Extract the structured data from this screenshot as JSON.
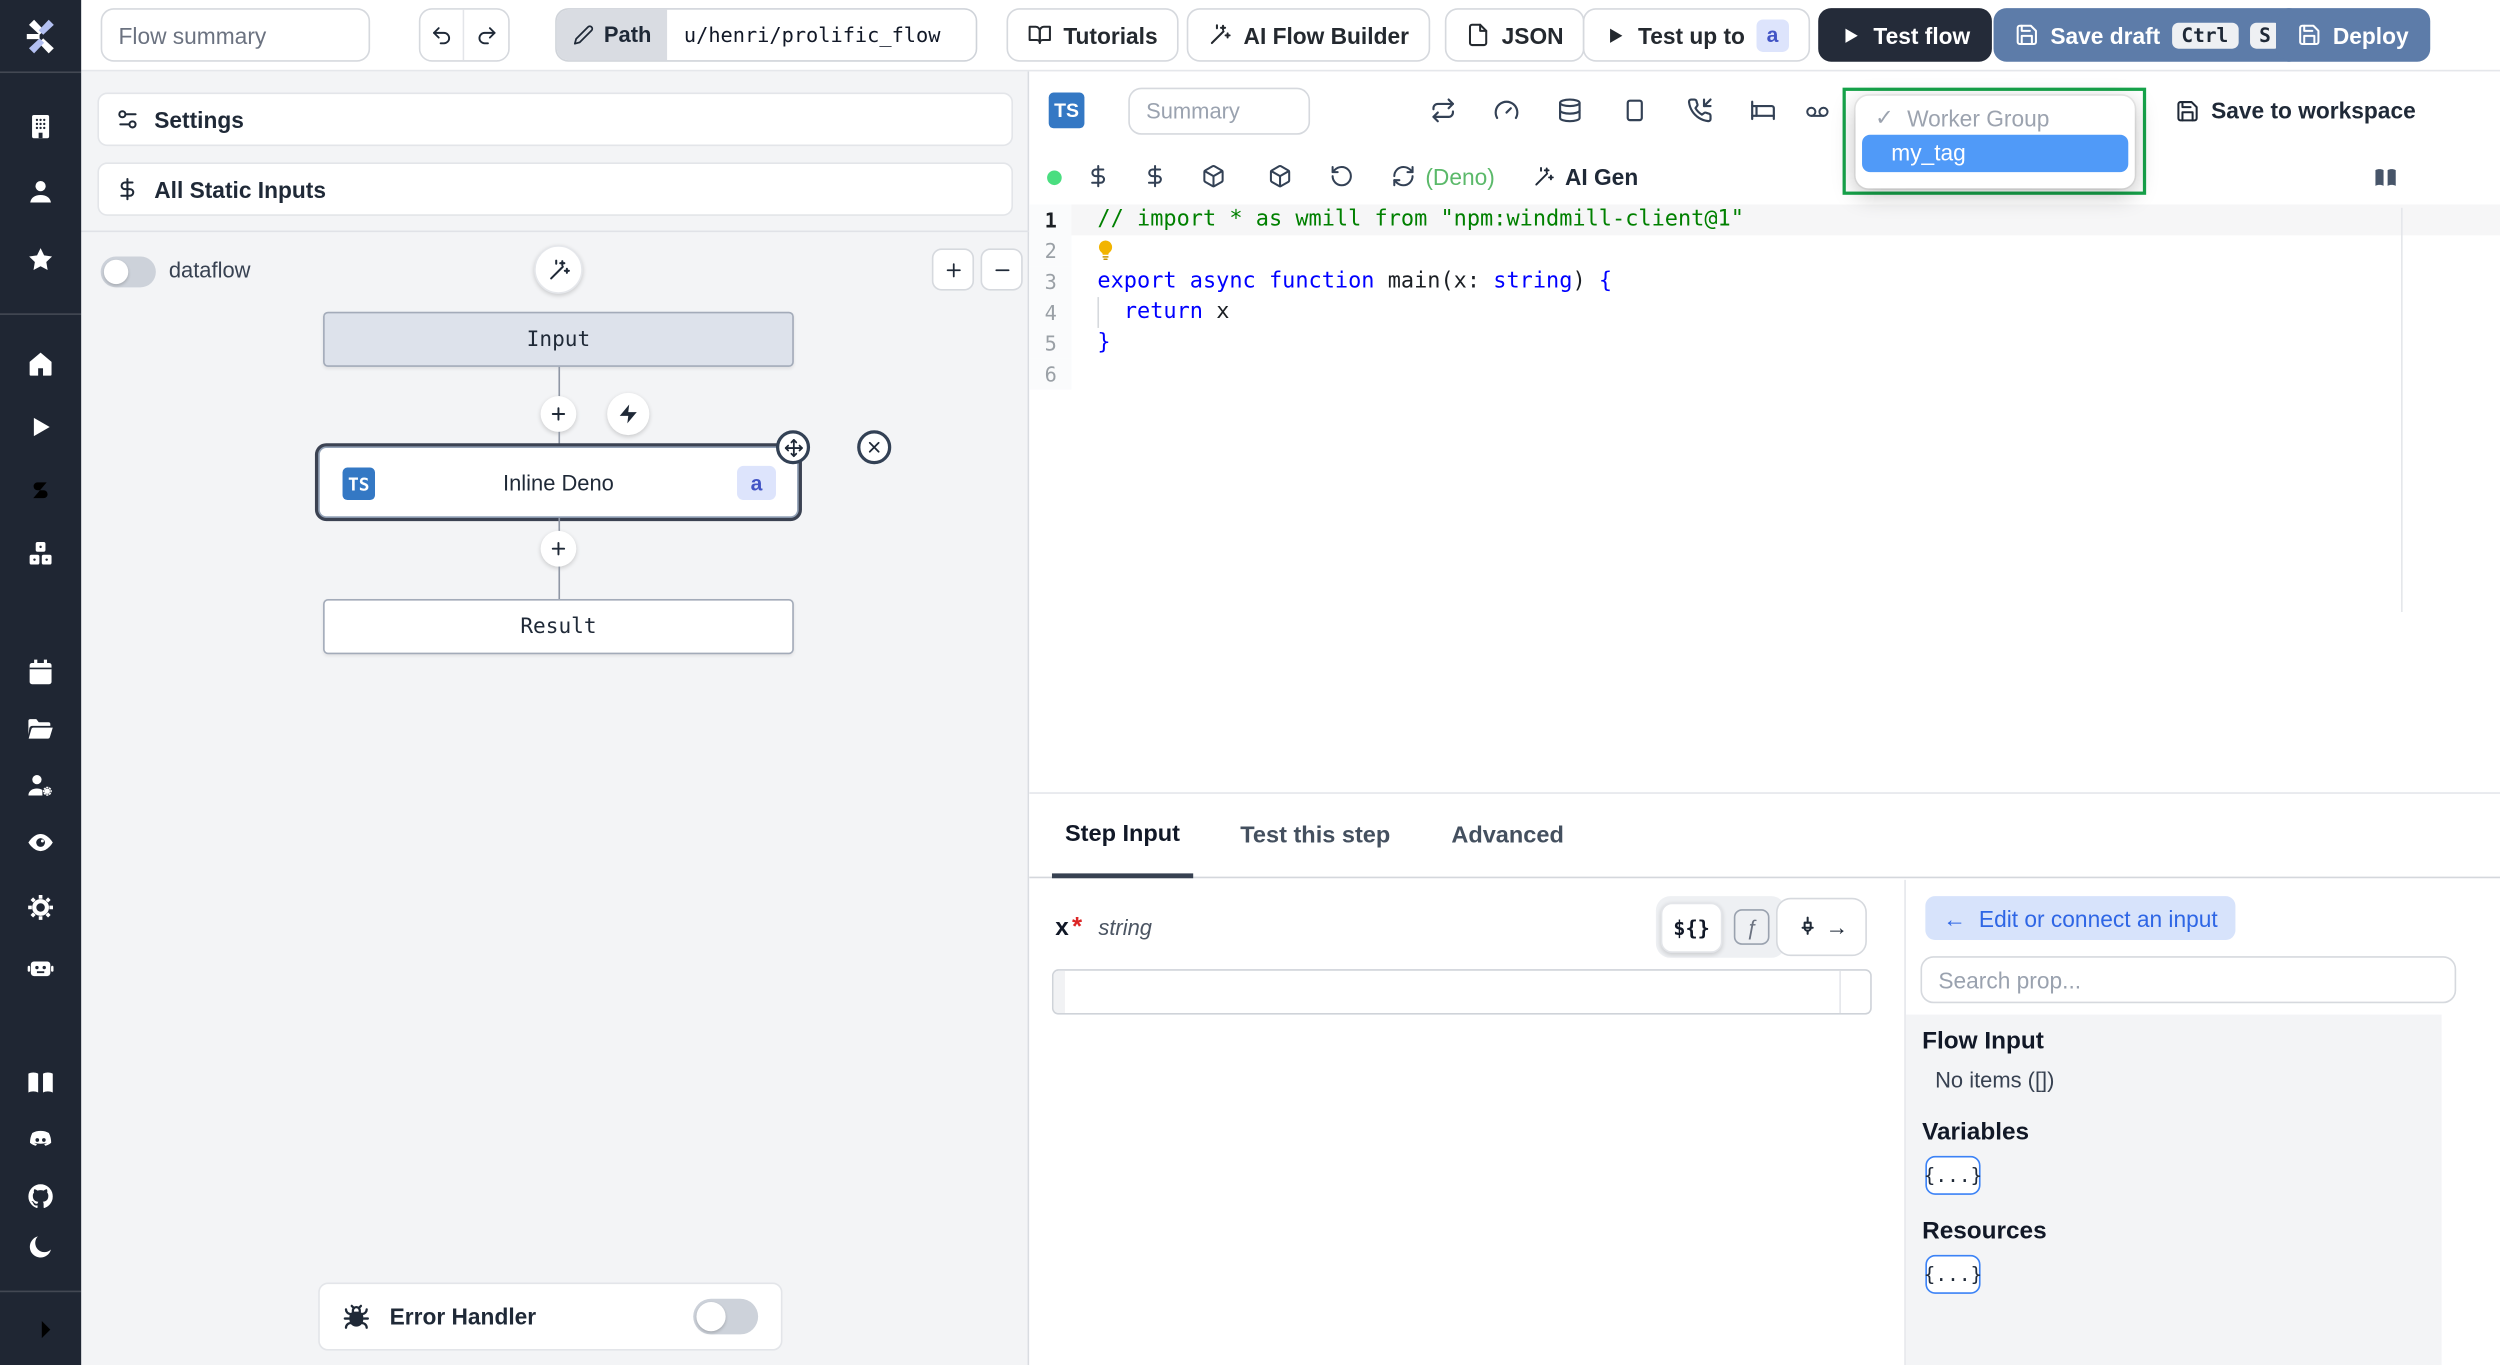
{
  "topbar": {
    "flow_summary_placeholder": "Flow summary",
    "path_label": "Path",
    "path_value": "u/henri/prolific_flow",
    "tutorials_label": "Tutorials",
    "ai_flow_builder_label": "AI Flow Builder",
    "json_label": "JSON",
    "test_up_to_label": "Test up to",
    "test_up_to_badge": "a",
    "test_flow_label": "Test flow",
    "save_draft_label": "Save draft",
    "kbd_ctrl": "Ctrl",
    "kbd_s": "S",
    "deploy_label": "Deploy"
  },
  "left_panel": {
    "settings_label": "Settings",
    "all_static_inputs_label": "All Static Inputs",
    "dataflow_label": "dataflow",
    "zoom_in_label": "+",
    "zoom_out_label": "−",
    "nodes": {
      "input_label": "Input",
      "step_label": "Inline Deno",
      "step_lang_badge": "TS",
      "step_id_badge": "a",
      "result_label": "Result"
    },
    "error_handler_label": "Error Handler"
  },
  "editor": {
    "lang_badge": "TS",
    "summary_placeholder": "Summary",
    "runtime_label": "(Deno)",
    "ai_gen_label": "AI Gen",
    "save_to_workspace_label": "Save to workspace",
    "tag_dropdown": {
      "checkmark": "✓",
      "group_label": "Worker Group",
      "selected_tag": "my_tag"
    },
    "code": {
      "lines": [
        {
          "number": "1",
          "active": true,
          "tokens": [
            {
              "type": "comment",
              "text": "// import * as wmill from \"npm:windmill-client@1\""
            }
          ]
        },
        {
          "number": "2",
          "lightbulb": true,
          "tokens": []
        },
        {
          "number": "3",
          "tokens": [
            {
              "type": "keyword",
              "text": "export async function"
            },
            {
              "type": "plain",
              "text": " main(x: "
            },
            {
              "type": "keyword",
              "text": "string"
            },
            {
              "type": "plain",
              "text": ") "
            },
            {
              "type": "keyword",
              "text": "{"
            }
          ]
        },
        {
          "number": "4",
          "guide": true,
          "tokens": [
            {
              "type": "plain",
              "text": "  "
            },
            {
              "type": "keyword",
              "text": "return"
            },
            {
              "type": "plain",
              "text": " x"
            }
          ]
        },
        {
          "number": "5",
          "tokens": [
            {
              "type": "keyword",
              "text": "}"
            }
          ]
        },
        {
          "number": "6",
          "tokens": []
        }
      ]
    }
  },
  "bottom": {
    "tabs": {
      "step_input": "Step Input",
      "test_this_step": "Test this step",
      "advanced": "Advanced"
    },
    "field": {
      "name": "x",
      "required_mark": "*",
      "type": "string",
      "template_toggle": "${}",
      "fn_toggle": "ƒ",
      "connect_arrow": "→"
    },
    "connect_panel": {
      "back_arrow": "←",
      "edit_or_connect_label": "Edit or connect an input",
      "search_placeholder": "Search prop...",
      "flow_input_title": "Flow Input",
      "flow_input_empty": "No items ([])",
      "variables_title": "Variables",
      "variables_chip": "{...}",
      "resources_title": "Resources",
      "resources_chip": "{...}"
    }
  },
  "colors": {
    "sidebar_bg": "#1f2633",
    "primary_dark_button": "#242b39",
    "action_blue_button": "#5d7ca9",
    "selection_blue": "#509af8",
    "highlight_green_border": "#16a34a",
    "ts_badge_blue": "#3478c4",
    "status_dot_green": "#4ade80",
    "runtime_green": "#5bb96a",
    "code_keyword": "#0000ff",
    "code_comment": "#008000",
    "badge_indigo_bg": "#dde4fc",
    "badge_indigo_text": "#4254c5"
  }
}
